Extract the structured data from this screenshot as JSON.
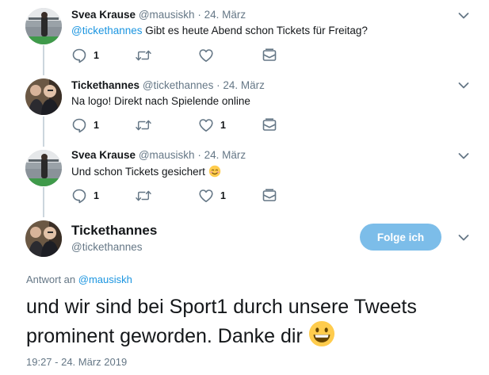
{
  "thread": [
    {
      "name": "Svea Krause",
      "handle": "@mausiskh",
      "separator": "·",
      "date": "24. März",
      "mention": "@tickethannes",
      "text": " Gibt es heute Abend schon Tickets für Freitag?",
      "reply_count": "1",
      "retweet_count": "",
      "like_count": ""
    },
    {
      "name": "Tickethannes",
      "handle": "@tickethannes",
      "separator": "·",
      "date": "24. März",
      "mention": "",
      "text": "Na logo! Direkt nach Spielende online",
      "reply_count": "1",
      "retweet_count": "",
      "like_count": "1"
    },
    {
      "name": "Svea Krause",
      "handle": "@mausiskh",
      "separator": "·",
      "date": "24. März",
      "mention": "",
      "text": "Und schon Tickets gesichert",
      "reply_count": "1",
      "retweet_count": "",
      "like_count": "1"
    }
  ],
  "main_tweet": {
    "name": "Tickethannes",
    "handle": "@tickethannes",
    "follow_label": "Folge ich",
    "reply_prefix": "Antwort an",
    "reply_mention": "@mausiskh",
    "text": "und wir sind bei Sport1 durch unsere Tweets prominent geworden. Danke dir",
    "timestamp": "19:27 - 24. März 2019"
  },
  "icons": {
    "reply": "reply-icon",
    "retweet": "retweet-icon",
    "like": "heart-icon",
    "dm": "envelope-icon",
    "menu": "chevron-down-icon",
    "emoji_blush": "smiling-face-icon",
    "emoji_grin": "grinning-face-icon"
  },
  "colors": {
    "link": "#1b95e0",
    "muted": "#657786",
    "follow_button": "#7cbde9",
    "thread_line": "#ccd6dd"
  }
}
